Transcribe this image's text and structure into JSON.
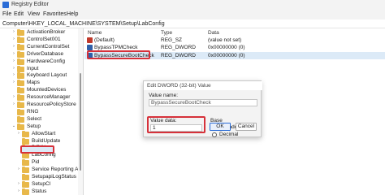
{
  "window": {
    "title": "Registry Editor"
  },
  "menu": [
    "File",
    "Edit",
    "View",
    "Favorites",
    "Help"
  ],
  "address": "Computer\\HKEY_LOCAL_MACHINE\\SYSTEM\\Setup\\LabConfig",
  "tree": [
    {
      "label": "ActivationBroker",
      "chev": ">"
    },
    {
      "label": "ControlSet001",
      "chev": ">"
    },
    {
      "label": "CurrentControlSet",
      "chev": ">"
    },
    {
      "label": "DriverDatabase",
      "chev": ">"
    },
    {
      "label": "HardwareConfig",
      "chev": ">"
    },
    {
      "label": "Input",
      "chev": ">"
    },
    {
      "label": "Keyboard Layout",
      "chev": ">"
    },
    {
      "label": "Maps",
      "chev": ">"
    },
    {
      "label": "MountedDevices",
      "chev": ""
    },
    {
      "label": "ResourceManager",
      "chev": ">"
    },
    {
      "label": "ResourcePolicyStore",
      "chev": ">"
    },
    {
      "label": "RNG",
      "chev": ""
    },
    {
      "label": "Select",
      "chev": ""
    },
    {
      "label": "Setup",
      "chev": "v"
    },
    {
      "label": "AllowStart",
      "chev": ">"
    },
    {
      "label": "BuildUpdate",
      "chev": ""
    },
    {
      "label": "DiDiN",
      "chev": ""
    },
    {
      "label": "LabConfig",
      "chev": ""
    },
    {
      "label": "Pid",
      "chev": ""
    },
    {
      "label": "Service Reporting API",
      "chev": ">"
    },
    {
      "label": "SetupapiLogStatus",
      "chev": ""
    },
    {
      "label": "SetupCl",
      "chev": ">"
    },
    {
      "label": "Status",
      "chev": ">"
    }
  ],
  "list": {
    "headers": {
      "name": "Name",
      "type": "Type",
      "data": "Data"
    },
    "rows": [
      {
        "name": "(Default)",
        "type": "REG_SZ",
        "data": "(value not set)",
        "icon": "string-value-icon"
      },
      {
        "name": "BypassTPMCheck",
        "type": "REG_DWORD",
        "data": "0x00000000 (0)",
        "icon": "binary-value-icon"
      },
      {
        "name": "BypassSecureBootCheck",
        "type": "REG_DWORD",
        "data": "0x00000000 (0)",
        "icon": "binary-value-icon"
      }
    ]
  },
  "dialog": {
    "title": "Edit DWORD (32-bit) Value",
    "value_name_label": "Value name:",
    "value_name": "BypassSecureBootCheck",
    "value_data_label": "Value data:",
    "value_data": "1",
    "base_label": "Base",
    "hex_label": "Hexadecimal",
    "dec_label": "Decimal",
    "base_selected": "Hexadecimal",
    "ok_label": "OK",
    "cancel_label": "Cancel"
  },
  "colors": {
    "highlight_red": "#d6313a",
    "accent": "#2b6cd6",
    "folder": "#e8b84a"
  }
}
